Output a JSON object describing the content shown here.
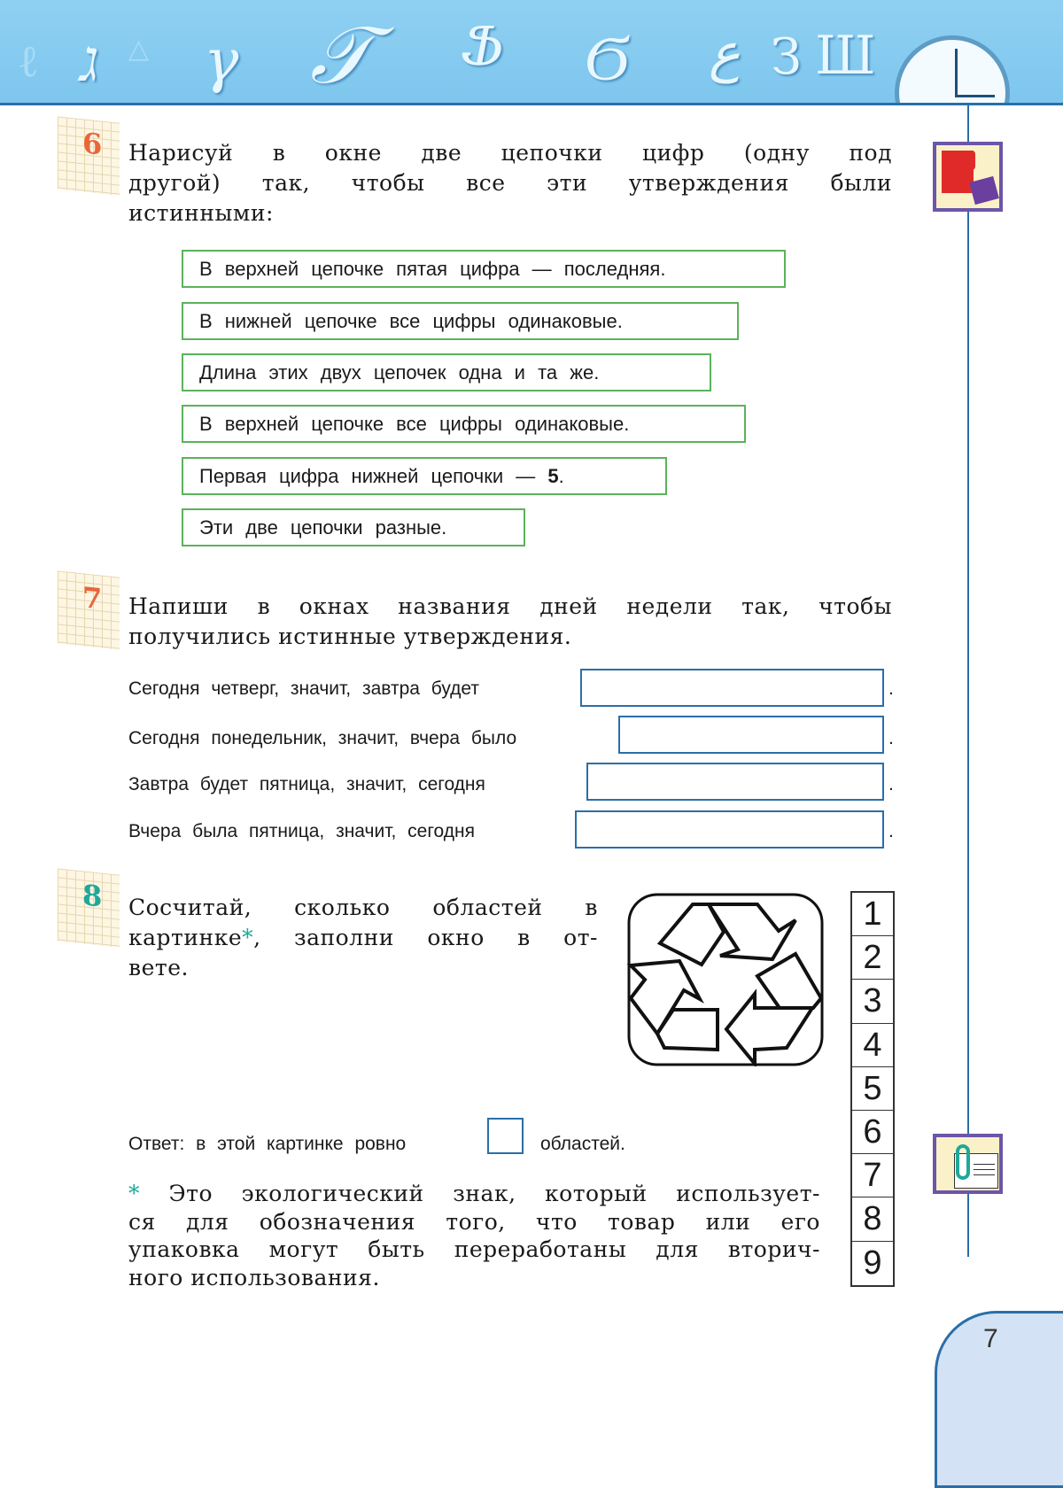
{
  "header": {
    "decorative_glyphs": [
      "ג",
      "γ",
      "𝒯",
      "Ֆ",
      "Ϭ",
      "ع",
      "З",
      "Ш"
    ],
    "clock": "clock-icon"
  },
  "colors": {
    "accent": "#2a6fa8",
    "task_number": "#e8663a",
    "task_number_8": "#1fa89a",
    "statement_border": "#5bb25b"
  },
  "task6": {
    "number": "6",
    "lines": [
      "Нарисуй в окне две цепочки цифр (одну под",
      "другой) так, чтобы все эти утверждения были",
      "истинными:"
    ],
    "statements": [
      "В верхней цепочке пятая цифра — последняя.",
      "В нижней цепочке все цифры одинаковые.",
      "Длина этих двух цепочек одна и та же.",
      "В верхней цепочке все цифры одинаковые."
    ],
    "statement5_prefix": "Первая цифра нижней цепочки — ",
    "statement5_bold": "5",
    "statement5_suffix": ".",
    "statement6": "Эти две цепочки разные."
  },
  "task7": {
    "number": "7",
    "lines": [
      "Напиши в окнах названия дней недели так, чтобы",
      "получились истинные утверждения."
    ],
    "rows": [
      {
        "text": "Сегодня четверг, значит, завтра будет",
        "value": ""
      },
      {
        "text": "Сегодня понедельник, значит, вчера было",
        "value": ""
      },
      {
        "text": "Завтра будет пятница, значит, сегодня",
        "value": ""
      },
      {
        "text": "Вчера была пятница, значит, сегодня",
        "value": ""
      }
    ],
    "period": "."
  },
  "task8": {
    "number": "8",
    "line1": "Сосчитай, сколько областей в",
    "line2_a": "картинке",
    "asterisk": "*",
    "line2_b": ", заполни окно в от-",
    "line3": "вете.",
    "answer_prefix": "Ответ: в этой картинке ровно",
    "answer_value": "",
    "answer_suffix": "областей.",
    "footnote": [
      "Это экологический знак, который использует-",
      "ся для обозначения того, что товар или его",
      "упаковка могут быть переработаны для вторич-",
      "ного использования."
    ]
  },
  "number_strip": [
    "1",
    "2",
    "3",
    "4",
    "5",
    "6",
    "7",
    "8",
    "9"
  ],
  "page_number": "7"
}
